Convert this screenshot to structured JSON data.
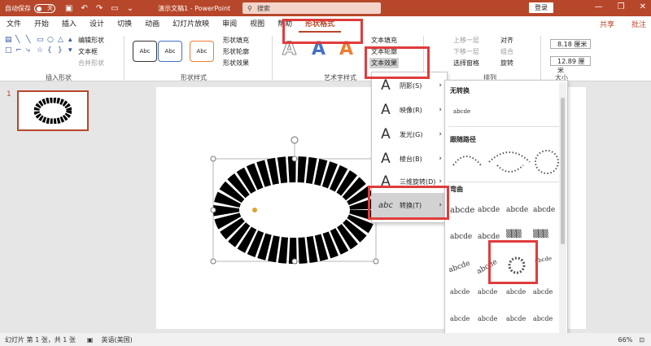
{
  "titlebar": {
    "autosave": "自动保存",
    "toggle": "关",
    "doc_title": "演示文稿1 - PowerPoint",
    "search_placeholder": "搜索",
    "login": "登录",
    "min": "—",
    "restore": "❐",
    "close": "✕"
  },
  "menu": {
    "tabs": [
      "文件",
      "开始",
      "插入",
      "设计",
      "切换",
      "动画",
      "幻灯片放映",
      "审阅",
      "视图",
      "帮助",
      "形状格式"
    ],
    "share": "共享",
    "notes": "批注"
  },
  "ribbon": {
    "insert_shapes": {
      "label": "插入形状",
      "edit_shape": "编辑形状",
      "textbox": "文本框",
      "merge": "合并形状"
    },
    "shape_styles": {
      "label": "形状样式",
      "samples": [
        "Abc",
        "Abc",
        "Abc"
      ],
      "fill": "形状填充",
      "outline": "形状轮廓",
      "effects": "形状效果"
    },
    "wordart": {
      "label": "艺术字样式",
      "text_fill": "文本填充",
      "text_outline": "文本轮廓",
      "text_effects": "文本效果"
    },
    "arrange": {
      "label": "排列",
      "forward": "上移一层",
      "backward": "下移一层",
      "pane": "选择窗格",
      "align": "对齐",
      "group": "组合",
      "rotate": "旋转"
    },
    "size": {
      "label": "大小",
      "height": "8.18 厘米",
      "width": "12.89 厘米"
    }
  },
  "effects_menu": {
    "items": [
      {
        "label": "阴影(S)"
      },
      {
        "label": "映像(R)"
      },
      {
        "label": "发光(G)"
      },
      {
        "label": "棱台(B)"
      },
      {
        "label": "三维旋转(D)"
      },
      {
        "label": "转换(T)"
      }
    ]
  },
  "transform_menu": {
    "no_transform": "无转换",
    "no_transform_sample": "abcde",
    "follow_path": "跟随路径",
    "warp": "弯曲",
    "sample": "abcde"
  },
  "slides": {
    "number": "1"
  },
  "status": {
    "slide_info": "幻灯片 第 1 张，共 1 张",
    "language": "英语(美国)",
    "zoom": "66%"
  },
  "colors": {
    "accent": "#b7472a",
    "highlight": "#e03c3c"
  }
}
